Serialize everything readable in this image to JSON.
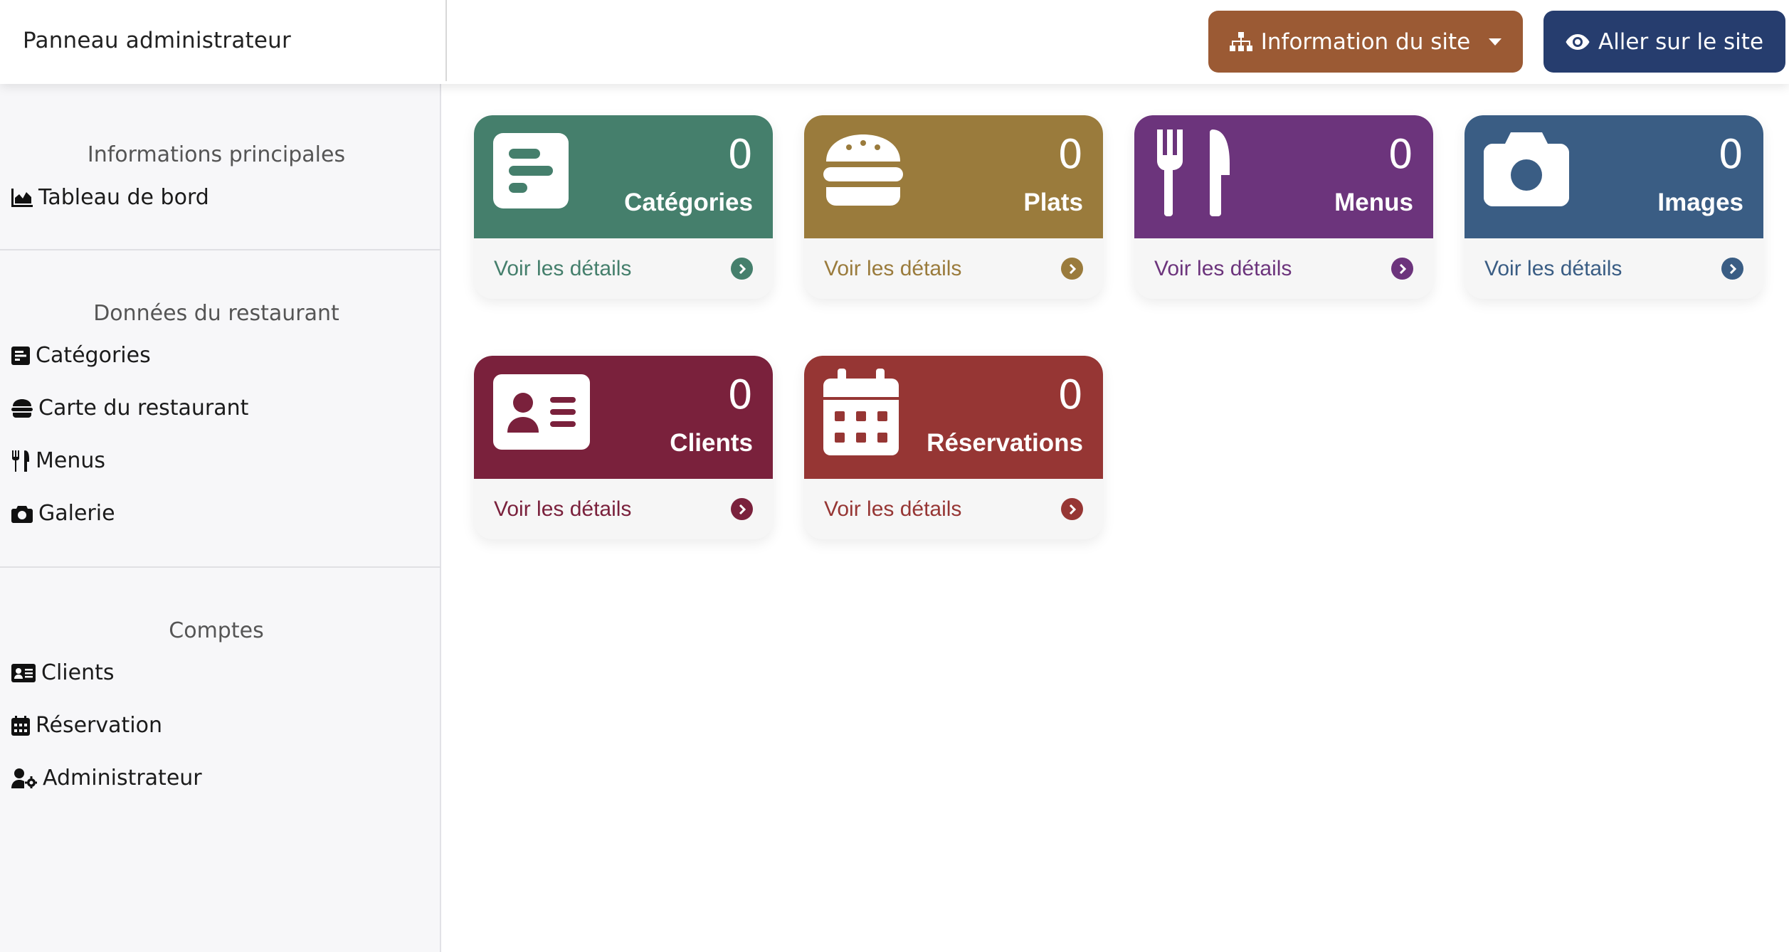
{
  "header": {
    "brand": "Panneau administrateur",
    "info_button": "Information du site",
    "site_button": "Aller sur le site"
  },
  "sidebar": {
    "sections": [
      {
        "heading": "Informations principales",
        "items": [
          {
            "label": "Tableau de bord",
            "icon": "chart-area-icon"
          }
        ]
      },
      {
        "heading": "Données du restaurant",
        "items": [
          {
            "label": "Catégories",
            "icon": "list-alt-icon"
          },
          {
            "label": "Carte du restaurant",
            "icon": "hamburger-icon"
          },
          {
            "label": "Menus",
            "icon": "utensils-icon"
          },
          {
            "label": "Galerie",
            "icon": "camera-icon"
          }
        ]
      },
      {
        "heading": "Comptes",
        "items": [
          {
            "label": "Clients",
            "icon": "id-card-icon"
          },
          {
            "label": "Réservation",
            "icon": "calendar-icon"
          },
          {
            "label": "Administrateur",
            "icon": "user-cog-icon"
          }
        ]
      }
    ]
  },
  "cards": [
    {
      "count": "0",
      "label": "Catégories",
      "link": "Voir les détails",
      "color": "#457f6c",
      "icon": "list-alt-icon"
    },
    {
      "count": "0",
      "label": "Plats",
      "link": "Voir les détails",
      "color": "#9a7b3c",
      "icon": "hamburger-icon"
    },
    {
      "count": "0",
      "label": "Menus",
      "link": "Voir les détails",
      "color": "#6c347c",
      "icon": "utensils-icon"
    },
    {
      "count": "0",
      "label": "Images",
      "link": "Voir les détails",
      "color": "#3a5d84",
      "icon": "camera-icon"
    },
    {
      "count": "0",
      "label": "Clients",
      "link": "Voir les détails",
      "color": "#7a213c",
      "icon": "id-card-icon"
    },
    {
      "count": "0",
      "label": "Réservations",
      "link": "Voir les détails",
      "color": "#963634",
      "icon": "calendar-icon"
    }
  ],
  "colors": {
    "info_button": "#9b5a34",
    "site_button": "#263d6e",
    "sidebar_bg": "#f7f7f9"
  }
}
